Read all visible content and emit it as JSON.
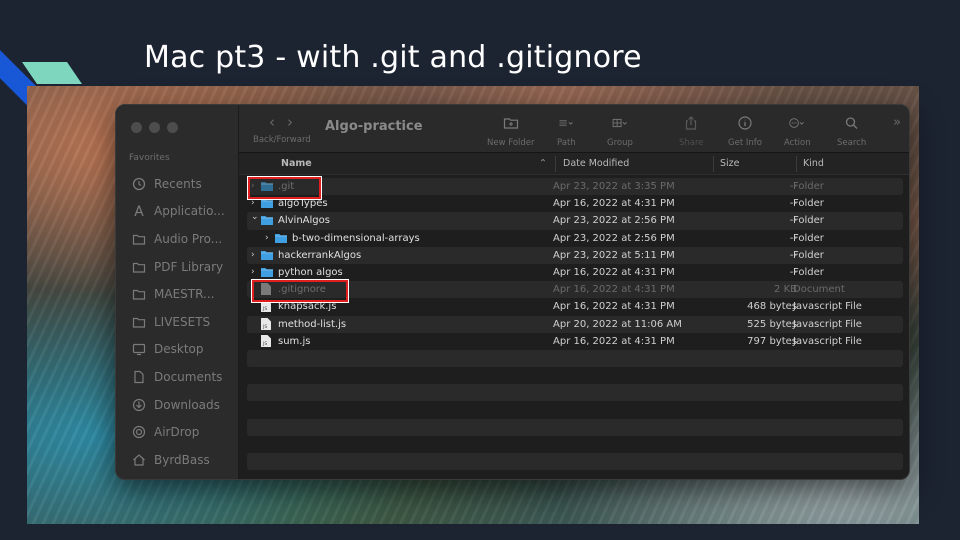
{
  "slide": {
    "title": "Mac pt3 - with .git and .gitignore"
  },
  "window": {
    "title": "Algo-practice",
    "nav_caption": "Back/Forward",
    "toolbar": [
      {
        "label": "New Folder",
        "icon": "new-folder-icon"
      },
      {
        "label": "Path",
        "icon": "path-icon"
      },
      {
        "label": "Group",
        "icon": "group-icon"
      },
      {
        "label": "Share",
        "icon": "share-icon"
      },
      {
        "label": "Get Info",
        "icon": "info-icon"
      },
      {
        "label": "Action",
        "icon": "action-icon"
      },
      {
        "label": "Search",
        "icon": "search-icon"
      }
    ],
    "more_glyph": "»"
  },
  "sidebar": {
    "section": "Favorites",
    "items": [
      {
        "label": "Recents",
        "icon": "clock-icon"
      },
      {
        "label": "Applicatio...",
        "icon": "applications-icon"
      },
      {
        "label": "Audio Pro...",
        "icon": "folder-icon"
      },
      {
        "label": "PDF Library",
        "icon": "folder-icon"
      },
      {
        "label": "MAESTR...",
        "icon": "folder-icon"
      },
      {
        "label": "LIVESETS",
        "icon": "folder-icon"
      },
      {
        "label": "Desktop",
        "icon": "desktop-icon"
      },
      {
        "label": "Documents",
        "icon": "document-icon"
      },
      {
        "label": "Downloads",
        "icon": "download-icon"
      },
      {
        "label": "AirDrop",
        "icon": "airdrop-icon"
      },
      {
        "label": "ByrdBass",
        "icon": "home-icon"
      }
    ]
  },
  "columns": {
    "name": "Name",
    "date": "Date Modified",
    "size": "Size",
    "kind": "Kind"
  },
  "files": [
    {
      "name": ".git",
      "date": "Apr 23, 2022 at 3:35 PM",
      "size": "--",
      "kind": "Folder",
      "type": "folder",
      "chevron": "›",
      "indent": 0,
      "dim": true
    },
    {
      "name": "algoTypes",
      "date": "Apr 16, 2022 at 4:31 PM",
      "size": "--",
      "kind": "Folder",
      "type": "folder",
      "chevron": "›",
      "indent": 0,
      "dim": false
    },
    {
      "name": "AlvinAlgos",
      "date": "Apr 23, 2022 at 2:56 PM",
      "size": "--",
      "kind": "Folder",
      "type": "folder",
      "chevron": "⌄",
      "indent": 0,
      "dim": false
    },
    {
      "name": "b-two-dimensional-arrays",
      "date": "Apr 23, 2022 at 2:56 PM",
      "size": "--",
      "kind": "Folder",
      "type": "folder",
      "chevron": "›",
      "indent": 1,
      "dim": false
    },
    {
      "name": "hackerrankAlgos",
      "date": "Apr 23, 2022 at 5:11 PM",
      "size": "--",
      "kind": "Folder",
      "type": "folder",
      "chevron": "›",
      "indent": 0,
      "dim": false
    },
    {
      "name": "python algos",
      "date": "Apr 16, 2022 at 4:31 PM",
      "size": "--",
      "kind": "Folder",
      "type": "folder",
      "chevron": "›",
      "indent": 0,
      "dim": false
    },
    {
      "name": ".gitignore",
      "date": "Apr 16, 2022 at 4:31 PM",
      "size": "2 KB",
      "kind": "Document",
      "type": "file",
      "chevron": "",
      "indent": 0,
      "dim": true
    },
    {
      "name": "knapsack.js",
      "date": "Apr 16, 2022 at 4:31 PM",
      "size": "468 bytes",
      "kind": "Javascript File",
      "type": "js",
      "chevron": "",
      "indent": 0,
      "dim": false
    },
    {
      "name": "method-list.js",
      "date": "Apr 20, 2022 at 11:06 AM",
      "size": "525 bytes",
      "kind": "Javascript File",
      "type": "js",
      "chevron": "",
      "indent": 0,
      "dim": false
    },
    {
      "name": "sum.js",
      "date": "Apr 16, 2022 at 4:31 PM",
      "size": "797 bytes",
      "kind": "Javascript File",
      "type": "js",
      "chevron": "",
      "indent": 0,
      "dim": false
    }
  ],
  "colors": {
    "folder": "#3f9fe0",
    "highlight": "#e02020"
  }
}
